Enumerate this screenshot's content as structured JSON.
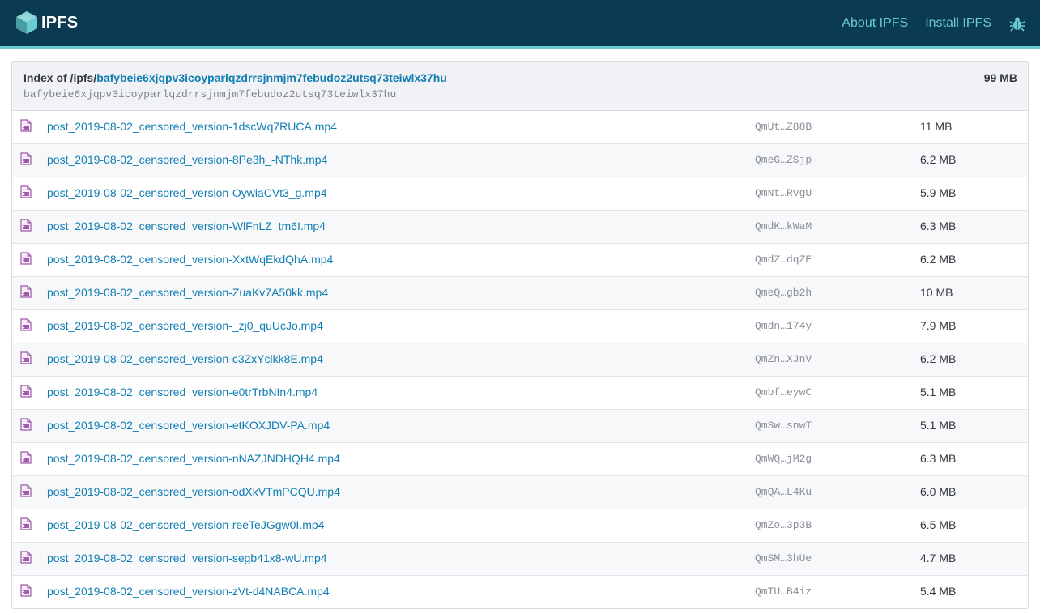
{
  "header": {
    "logo_text": "IPFS",
    "nav": {
      "about": "About IPFS",
      "install": "Install IPFS"
    },
    "bug_icon": "bug-icon",
    "colors": {
      "bar": "#0b3a53",
      "accent": "#6acad1"
    }
  },
  "listing": {
    "index_prefix": "Index of /ipfs/",
    "cid": "bafybeie6xjqpv3icoyparlqzdrrsjnmjm7febudoz2utsq73teiwlx37hu",
    "cid_sub": "bafybeie6xjqpv3icoyparlqzdrrsjnmjm7febudoz2utsq73teiwlx37hu",
    "total_size": "99 MB",
    "file_icon": "video-file-icon",
    "files": [
      {
        "name": "post_2019-08-02_censored_version-1dscWq7RUCA.mp4",
        "hash": "QmUt…Z88B",
        "size": "11 MB"
      },
      {
        "name": "post_2019-08-02_censored_version-8Pe3h_-NThk.mp4",
        "hash": "QmeG…ZSjp",
        "size": "6.2 MB"
      },
      {
        "name": "post_2019-08-02_censored_version-OywiaCVt3_g.mp4",
        "hash": "QmNt…RvgU",
        "size": "5.9 MB"
      },
      {
        "name": "post_2019-08-02_censored_version-WlFnLZ_tm6I.mp4",
        "hash": "QmdK…kWaM",
        "size": "6.3 MB"
      },
      {
        "name": "post_2019-08-02_censored_version-XxtWqEkdQhA.mp4",
        "hash": "QmdZ…dqZE",
        "size": "6.2 MB"
      },
      {
        "name": "post_2019-08-02_censored_version-ZuaKv7A50kk.mp4",
        "hash": "QmeQ…gb2h",
        "size": "10 MB"
      },
      {
        "name": "post_2019-08-02_censored_version-_zj0_quUcJo.mp4",
        "hash": "Qmdn…174y",
        "size": "7.9 MB"
      },
      {
        "name": "post_2019-08-02_censored_version-c3ZxYclkk8E.mp4",
        "hash": "QmZn…XJnV",
        "size": "6.2 MB"
      },
      {
        "name": "post_2019-08-02_censored_version-e0trTrbNIn4.mp4",
        "hash": "Qmbf…eywC",
        "size": "5.1 MB"
      },
      {
        "name": "post_2019-08-02_censored_version-etKOXJDV-PA.mp4",
        "hash": "QmSw…snwT",
        "size": "5.1 MB"
      },
      {
        "name": "post_2019-08-02_censored_version-nNAZJNDHQH4.mp4",
        "hash": "QmWQ…jM2g",
        "size": "6.3 MB"
      },
      {
        "name": "post_2019-08-02_censored_version-odXkVTmPCQU.mp4",
        "hash": "QmQA…L4Ku",
        "size": "6.0 MB"
      },
      {
        "name": "post_2019-08-02_censored_version-reeTeJGgw0I.mp4",
        "hash": "QmZo…3p3B",
        "size": "6.5 MB"
      },
      {
        "name": "post_2019-08-02_censored_version-segb41x8-wU.mp4",
        "hash": "QmSM…3hUe",
        "size": "4.7 MB"
      },
      {
        "name": "post_2019-08-02_censored_version-zVt-d4NABCA.mp4",
        "hash": "QmTU…B4iz",
        "size": "5.4 MB"
      }
    ]
  }
}
